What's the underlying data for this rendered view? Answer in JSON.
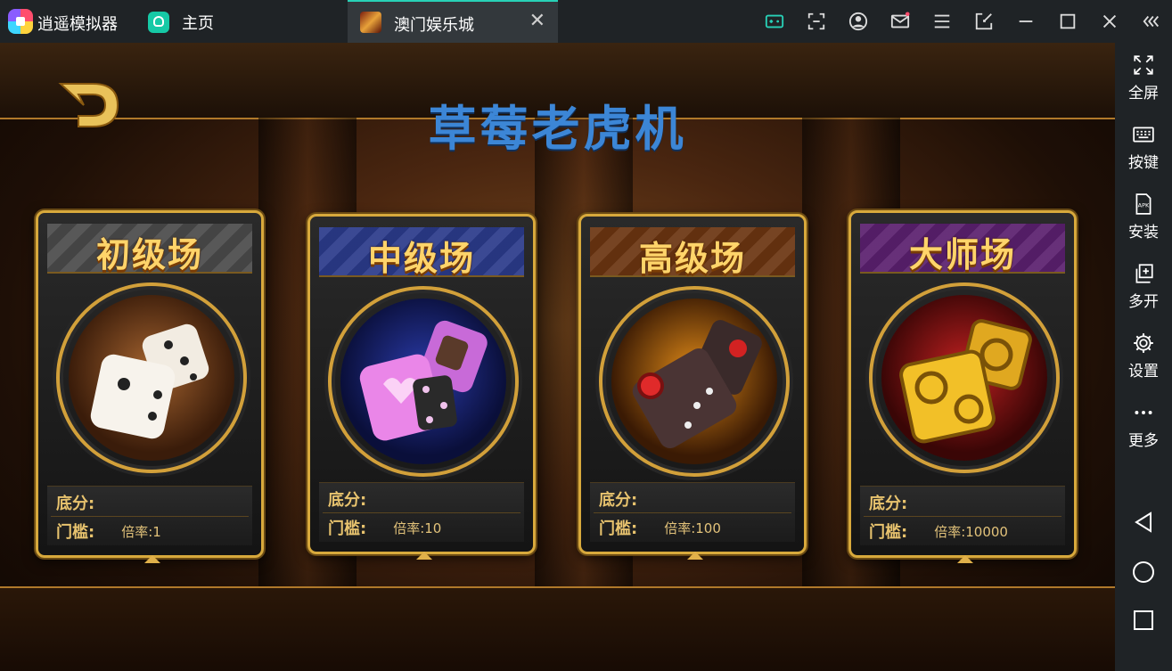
{
  "titlebar": {
    "app_name": "逍遥模拟器",
    "home_tab": "主页",
    "active_tab": "澳门娱乐城",
    "close_glyph": "✕",
    "icons": [
      "gamepad-icon",
      "screenshot-icon",
      "account-icon",
      "mail-icon",
      "menu-icon",
      "exit-window-icon",
      "minimize-icon",
      "maximize-icon",
      "close-icon",
      "collapse-icon"
    ]
  },
  "sidebar": {
    "items": [
      {
        "label": "全屏",
        "icon": "fullscreen-icon"
      },
      {
        "label": "按键",
        "icon": "keyboard-icon"
      },
      {
        "label": "安装",
        "icon": "apk-icon"
      },
      {
        "label": "多开",
        "icon": "multi-instance-icon"
      },
      {
        "label": "设置",
        "icon": "gear-icon"
      },
      {
        "label": "更多",
        "icon": "more-icon"
      }
    ],
    "nav": [
      "back-icon",
      "home-circle-icon",
      "recents-icon"
    ]
  },
  "game": {
    "title": "草莓老虎机",
    "cards": [
      {
        "title": "初级场",
        "base_label": "底分:",
        "base_value": "",
        "threshold_label": "门槛:",
        "rate": "倍率:1",
        "theme": "#c9c9c9"
      },
      {
        "title": "中级场",
        "base_label": "底分:",
        "base_value": "",
        "threshold_label": "门槛:",
        "rate": "倍率:10",
        "theme": "#3a4fb0"
      },
      {
        "title": "高级场",
        "base_label": "底分:",
        "base_value": "",
        "threshold_label": "门槛:",
        "rate": "倍率:100",
        "theme": "#b85a10"
      },
      {
        "title": "大师场",
        "base_label": "底分:",
        "base_value": "",
        "threshold_label": "门槛:",
        "rate": "倍率:10000",
        "theme": "#7a2a9a"
      }
    ]
  },
  "colors": {
    "accent": "#28d1b7",
    "title_blue": "#3c86d6",
    "gold": "#d8a93c"
  }
}
